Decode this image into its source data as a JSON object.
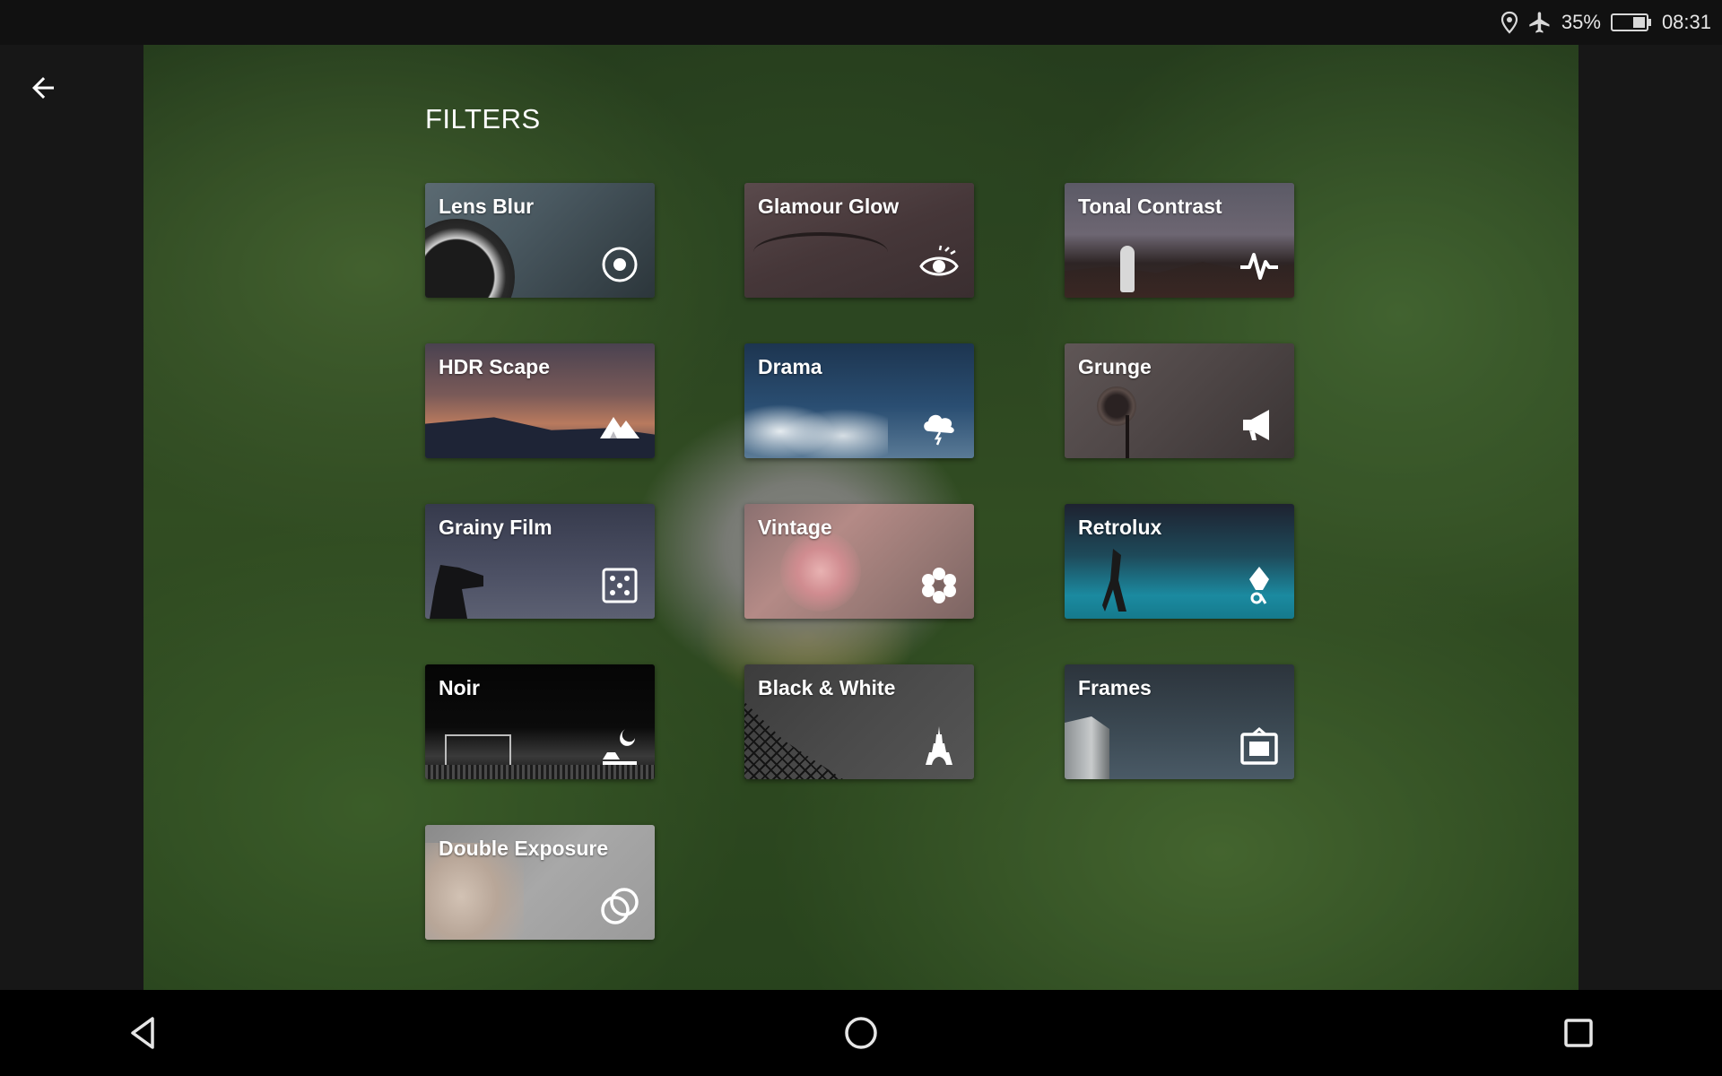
{
  "status_bar": {
    "icons": [
      "location-icon",
      "airplane-icon",
      "battery-icon"
    ],
    "battery": "35%",
    "time": "08:31"
  },
  "header": {
    "back_icon": "arrow-left-icon",
    "title": "FILTERS"
  },
  "filters": [
    {
      "label": "Lens Blur",
      "icon": "target-icon"
    },
    {
      "label": "Glamour Glow",
      "icon": "eye-icon"
    },
    {
      "label": "Tonal Contrast",
      "icon": "pulse-icon"
    },
    {
      "label": "HDR Scape",
      "icon": "mountain-icon"
    },
    {
      "label": "Drama",
      "icon": "storm-cloud-icon"
    },
    {
      "label": "Grunge",
      "icon": "megaphone-icon"
    },
    {
      "label": "Grainy Film",
      "icon": "dice-icon"
    },
    {
      "label": "Vintage",
      "icon": "flower-icon"
    },
    {
      "label": "Retrolux",
      "icon": "pin-icon"
    },
    {
      "label": "Noir",
      "icon": "moon-night-icon"
    },
    {
      "label": "Black & White",
      "icon": "eiffel-tower-icon"
    },
    {
      "label": "Frames",
      "icon": "frame-icon"
    },
    {
      "label": "Double Exposure",
      "icon": "overlap-circles-icon"
    }
  ],
  "nav_bar": {
    "buttons": [
      "back-triangle-icon",
      "home-circle-icon",
      "recents-square-icon"
    ]
  },
  "colors": {
    "background": "#171717",
    "status_bar": "#111111",
    "nav_bar": "#000000",
    "text": "#ffffff"
  }
}
